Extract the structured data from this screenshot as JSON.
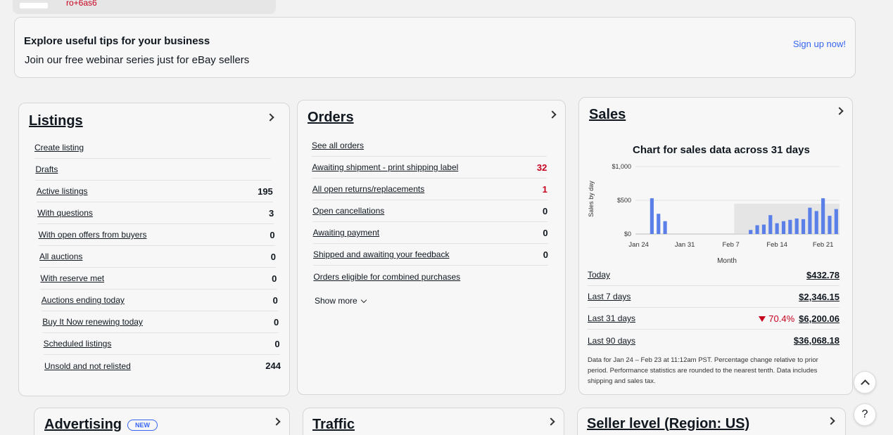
{
  "topbar": {
    "text": "ro+6as6"
  },
  "banner": {
    "title": "Explore useful tips for your business",
    "subtitle": "Join our free webinar series just for eBay sellers",
    "cta": "Sign up now!"
  },
  "listings": {
    "title": "Listings",
    "rows": [
      {
        "label": "Create listing",
        "value": ""
      },
      {
        "label": "Drafts",
        "value": ""
      },
      {
        "label": "Active listings",
        "value": "195"
      },
      {
        "label": "With questions",
        "value": "3"
      },
      {
        "label": "With open offers from buyers",
        "value": "0"
      },
      {
        "label": "All auctions",
        "value": "0"
      },
      {
        "label": "With reserve met",
        "value": "0"
      },
      {
        "label": "Auctions ending today",
        "value": "0"
      },
      {
        "label": "Buy It Now renewing today",
        "value": "0"
      },
      {
        "label": "Scheduled listings",
        "value": "0"
      },
      {
        "label": "Unsold and not relisted",
        "value": "244"
      }
    ]
  },
  "orders": {
    "title": "Orders",
    "rows": [
      {
        "label": "See all orders",
        "value": ""
      },
      {
        "label": "Awaiting shipment - print shipping label",
        "value": "32"
      },
      {
        "label": "All open returns/replacements",
        "value": "1"
      },
      {
        "label": "Open cancellations",
        "value": "0"
      },
      {
        "label": "Awaiting payment",
        "value": "0"
      },
      {
        "label": "Shipped and awaiting your feedback",
        "value": "0"
      },
      {
        "label": "Orders eligible for combined purchases",
        "value": ""
      }
    ],
    "show_more": "Show more"
  },
  "sales": {
    "title": "Sales",
    "periods": [
      {
        "label": "Today",
        "value": "$432.78",
        "change": ""
      },
      {
        "label": "Last 7 days",
        "value": "$2,346.15",
        "change": ""
      },
      {
        "label": "Last 31 days",
        "value": "$6,200.06",
        "change": "70.4%"
      },
      {
        "label": "Last 90 days",
        "value": "$36,068.18",
        "change": ""
      }
    ],
    "footnote": "Data for Jan 24 – Feb 23 at 11:12am PST. Percentage change relative to prior period. Performance statistics are rounded to the nearest tenth. Data includes shipping and sales tax."
  },
  "chart_data": {
    "type": "bar",
    "title": "Chart for sales data across 31 days",
    "xlabel": "Month",
    "ylabel": "Sales by day",
    "ylim": [
      0,
      1000
    ],
    "yticks": [
      "$1,000",
      "$500",
      "$0"
    ],
    "xticks": [
      "Jan 24",
      "Jan 31",
      "Feb 7",
      "Feb 14",
      "Feb 21"
    ],
    "categories": [
      "Jan 24",
      "Jan 25",
      "Jan 26",
      "Jan 27",
      "Jan 28",
      "Jan 29",
      "Jan 30",
      "Jan 31",
      "Feb 1",
      "Feb 2",
      "Feb 3",
      "Feb 4",
      "Feb 5",
      "Feb 6",
      "Feb 7",
      "Feb 8",
      "Feb 9",
      "Feb 10",
      "Feb 11",
      "Feb 12",
      "Feb 13",
      "Feb 14",
      "Feb 15",
      "Feb 16",
      "Feb 17",
      "Feb 18",
      "Feb 19",
      "Feb 20",
      "Feb 21",
      "Feb 22",
      "Feb 23"
    ],
    "values": [
      0,
      0,
      530,
      300,
      190,
      0,
      0,
      0,
      0,
      0,
      0,
      0,
      0,
      0,
      0,
      0,
      0,
      60,
      130,
      140,
      280,
      160,
      190,
      210,
      230,
      220,
      390,
      340,
      530,
      270,
      370
    ],
    "colors": {
      "bar": "#5b7fe8",
      "highlight": "#d8d8d8"
    }
  },
  "advertising": {
    "title": "Advertising",
    "badge": "NEW"
  },
  "traffic": {
    "title": "Traffic"
  },
  "seller_level": {
    "title": "Seller level (Region: US)"
  },
  "help": {
    "icon": "?"
  }
}
